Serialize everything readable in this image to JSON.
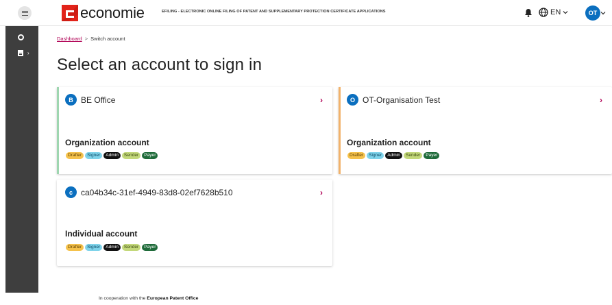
{
  "header": {
    "logo_text": "economie",
    "app_subtitle": "EFILING - ELECTRONIC ONLINE FILING OF PATENT AND SUPPLEMENTARY PROTECTION CERTIFICATE APPLICATIONS",
    "language": "EN",
    "user_initials": "OT",
    "icons": [
      "menu-icon",
      "bell-icon",
      "globe-icon",
      "chevron-down-icon"
    ]
  },
  "sidebar": {
    "items": [
      {
        "icon": "circle-icon"
      },
      {
        "icon": "document-icon"
      }
    ]
  },
  "breadcrumb": {
    "link": "Dashboard",
    "separator": ">",
    "current": "Switch account"
  },
  "page_title": "Select an account to sign in",
  "accounts": [
    {
      "initial": "B",
      "name": "BE Office",
      "type": "Organization account",
      "accent": "#9ed6b0",
      "roles": [
        "Drafter",
        "Signer",
        "Admin",
        "Sender",
        "Payer"
      ]
    },
    {
      "initial": "O",
      "name": "OT-Organisation Test",
      "type": "Organization account",
      "accent": "#f2b26a",
      "roles": [
        "Drafter",
        "Signer",
        "Admin",
        "Sender",
        "Payer"
      ]
    },
    {
      "initial": "c",
      "name": "ca04b34c-31ef-4949-83d8-02ef7628b510",
      "type": "Individual account",
      "accent": "",
      "roles": [
        "Drafter",
        "Signer",
        "Admin",
        "Sender",
        "Payer"
      ]
    }
  ],
  "footer": {
    "prefix": "In cooperation with the",
    "org": "European Patent Office"
  },
  "colors": {
    "brand_red": "#e2231a",
    "link": "#b00055",
    "avatar": "#0b6fbf",
    "sidebar": "#3e3e3e"
  }
}
